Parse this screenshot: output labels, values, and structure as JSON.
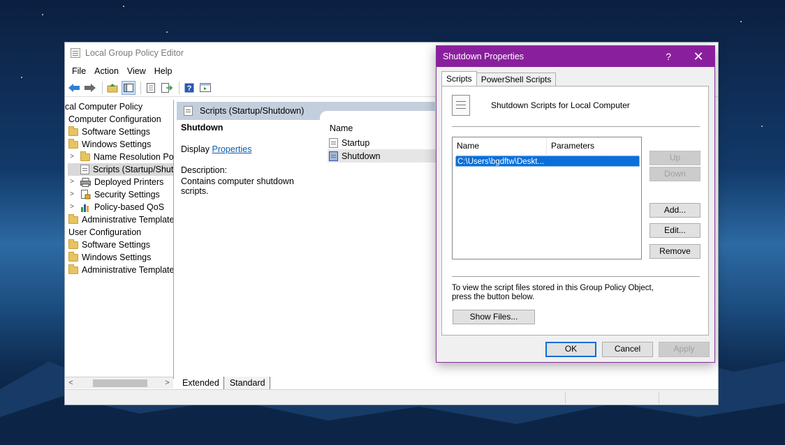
{
  "main_window": {
    "title": "Local Group Policy Editor",
    "menu": [
      "File",
      "Action",
      "View",
      "Help"
    ],
    "tree": [
      {
        "label": "cal Computer Policy",
        "level": 0,
        "icon": "doc-icon",
        "expander": ""
      },
      {
        "label": "Computer Configuration",
        "level": 0,
        "icon": "computer-icon",
        "expander": ""
      },
      {
        "label": "Software Settings",
        "level": 1,
        "icon": "folder-icon",
        "expander": ""
      },
      {
        "label": "Windows Settings",
        "level": 1,
        "icon": "folder-icon",
        "expander": ""
      },
      {
        "label": "Name Resolution Pol",
        "level": 2,
        "icon": "folder-icon",
        "expander": ">"
      },
      {
        "label": "Scripts (Startup/Shutd",
        "level": 2,
        "icon": "script-icon",
        "expander": "",
        "selected": true
      },
      {
        "label": "Deployed Printers",
        "level": 2,
        "icon": "printer-icon",
        "expander": ">"
      },
      {
        "label": "Security Settings",
        "level": 2,
        "icon": "security-icon",
        "expander": ">"
      },
      {
        "label": "Policy-based QoS",
        "level": 2,
        "icon": "chart-icon",
        "expander": ">"
      },
      {
        "label": "Administrative Template:",
        "level": 1,
        "icon": "folder-icon",
        "expander": ""
      },
      {
        "label": "User Configuration",
        "level": 0,
        "icon": "user-icon",
        "expander": ""
      },
      {
        "label": "Software Settings",
        "level": 1,
        "icon": "folder-icon",
        "expander": ""
      },
      {
        "label": "Windows Settings",
        "level": 1,
        "icon": "folder-icon",
        "expander": ""
      },
      {
        "label": "Administrative Template:",
        "level": 1,
        "icon": "folder-icon",
        "expander": ""
      }
    ],
    "content": {
      "header": "Scripts (Startup/Shutdown)",
      "selected_title": "Shutdown",
      "display_prefix": "Display",
      "properties_link": "Properties",
      "description_label": "Description:",
      "description_text": "Contains computer shutdown scripts.",
      "list_column": "Name",
      "list_items": [
        "Startup",
        "Shutdown"
      ]
    },
    "bottom_tabs": [
      "Extended",
      "Standard"
    ]
  },
  "dialog": {
    "title": "Shutdown Properties",
    "help_glyph": "?",
    "close_glyph": "✕",
    "tabs": [
      "Scripts",
      "PowerShell Scripts"
    ],
    "header_text": "Shutdown Scripts for Local Computer",
    "columns": [
      "Name",
      "Parameters"
    ],
    "rows": [
      {
        "name": "C:\\Users\\bgdftw\\Deskt...",
        "parameters": ""
      }
    ],
    "buttons": {
      "up": "Up",
      "down": "Down",
      "add": "Add...",
      "edit": "Edit...",
      "remove": "Remove"
    },
    "note": "To view the script files stored in this Group Policy Object, press the button below.",
    "show_files": "Show Files...",
    "ok": "OK",
    "cancel": "Cancel",
    "apply": "Apply"
  },
  "colors": {
    "dialog_titlebar": "#8a1f9d",
    "selection": "#0a6fd8",
    "link": "#0b5cad"
  }
}
